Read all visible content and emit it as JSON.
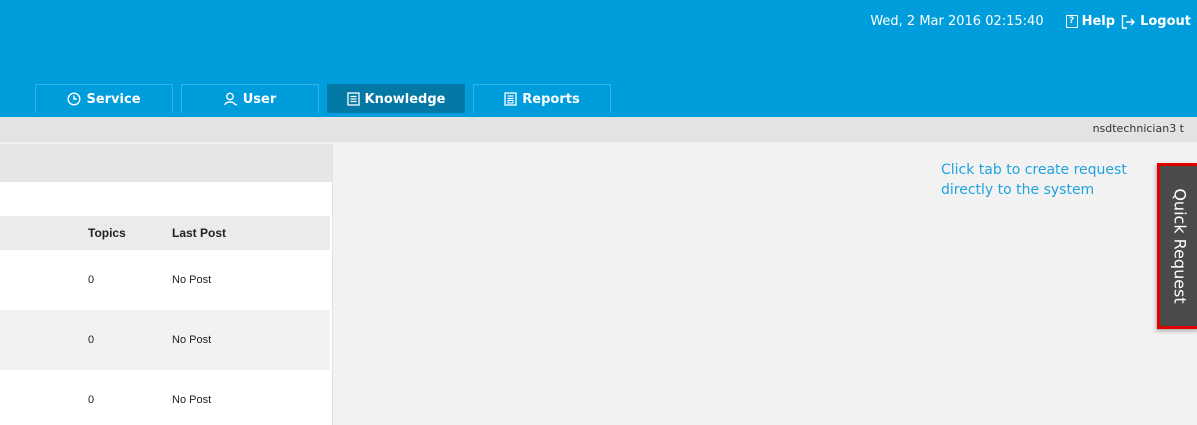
{
  "header": {
    "datetime": "Wed, 2 Mar 2016 02:15:40",
    "help_label": "Help",
    "logout_label": "Logout"
  },
  "tabs": [
    {
      "label": "Service",
      "icon": "clock-icon",
      "active": false
    },
    {
      "label": "User",
      "icon": "user-icon",
      "active": false
    },
    {
      "label": "Knowledge",
      "icon": "book-icon",
      "active": true
    },
    {
      "label": "Reports",
      "icon": "report-icon",
      "active": false
    }
  ],
  "userbar": {
    "username": "nsdtechnician3 t"
  },
  "forum_table": {
    "columns": [
      "Topics",
      "Last Post"
    ],
    "rows": [
      {
        "topics": "0",
        "last_post": "No Post"
      },
      {
        "topics": "0",
        "last_post": "No Post"
      },
      {
        "topics": "0",
        "last_post": "No Post"
      }
    ]
  },
  "quick_request": {
    "hint": "Click tab to create request directly to the system",
    "label": "Quick Request"
  },
  "colors": {
    "header_bg": "#009ddc",
    "active_tab": "#0479a6",
    "hint_text": "#1fa4de",
    "quick_tab_bg": "#4a4a4a",
    "quick_tab_border": "#e00000"
  }
}
